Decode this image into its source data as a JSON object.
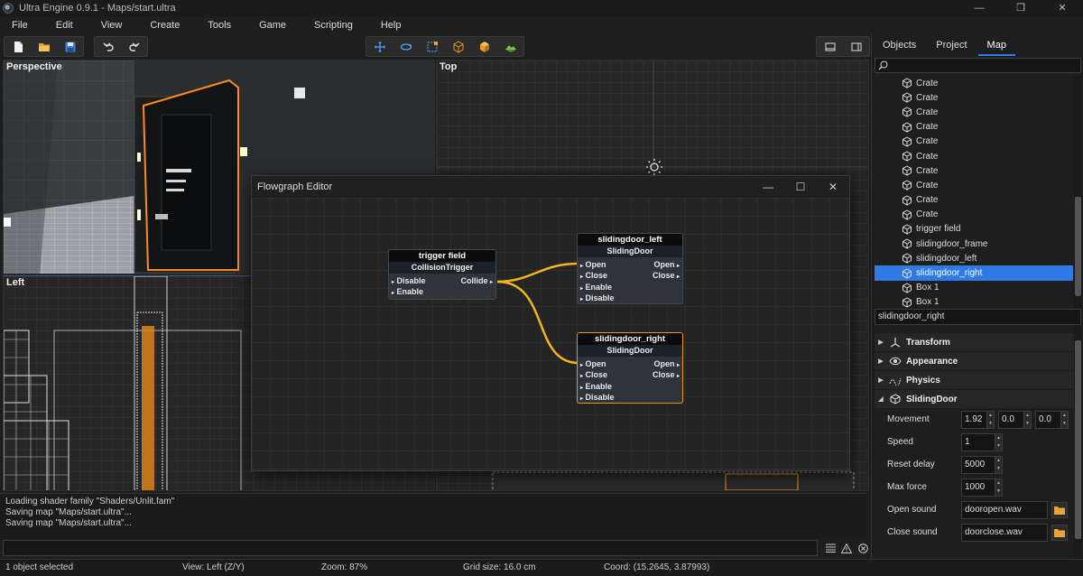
{
  "window": {
    "title": "Ultra Engine 0.9.1 - Maps/start.ultra",
    "min": "—",
    "max": "❐",
    "close": "✕"
  },
  "menu": [
    "File",
    "Edit",
    "View",
    "Create",
    "Tools",
    "Game",
    "Scripting",
    "Help"
  ],
  "viewports": {
    "perspective": "Perspective",
    "top": "Top",
    "left": "Left"
  },
  "console": {
    "lines": [
      "Loading shader family \"Shaders/Unlit.fam\"",
      "Saving map \"Maps/start.ultra\"...",
      "Saving map \"Maps/start.ultra\"..."
    ]
  },
  "status": {
    "selection": "1 object selected",
    "view": "View: Left (Z/Y)",
    "zoom": "Zoom: 87%",
    "grid": "Grid size: 16.0 cm",
    "coord": "Coord: (15.2645, 3.87993)"
  },
  "right_panel": {
    "tabs": [
      "Objects",
      "Project",
      "Map"
    ],
    "active_tab": "Map",
    "tree": [
      "Crate",
      "Crate",
      "Crate",
      "Crate",
      "Crate",
      "Crate",
      "Crate",
      "Crate",
      "Crate",
      "Crate",
      "trigger field",
      "slidingdoor_frame",
      "slidingdoor_left",
      "slidingdoor_right",
      "Box 1",
      "Box 1"
    ],
    "selected_index": 13,
    "name_field": "slidingdoor_right",
    "sections": [
      "Transform",
      "Appearance",
      "Physics",
      "SlidingDoor"
    ],
    "props": {
      "movement_label": "Movement",
      "movement": [
        "1.92",
        "0.0",
        "0.0"
      ],
      "speed_label": "Speed",
      "speed": "1",
      "reset_label": "Reset delay",
      "reset": "5000",
      "maxforce_label": "Max force",
      "maxforce": "1000",
      "opensound_label": "Open sound",
      "opensound": "dooropen.wav",
      "closesound_label": "Close sound",
      "closesound": "doorclose.wav"
    }
  },
  "flowgraph": {
    "title": "Flowgraph Editor",
    "ctrl_min": "—",
    "ctrl_max": "☐",
    "ctrl_close": "✕",
    "trigger": {
      "name": "trigger field",
      "class": "CollisionTrigger",
      "in1": "Disable",
      "in2": "Enable",
      "out1": "Collide"
    },
    "door_left": {
      "name": "slidingdoor_left",
      "class": "SlidingDoor",
      "in1": "Open",
      "in2": "Close",
      "in3": "Enable",
      "in4": "Disable",
      "out1": "Open",
      "out2": "Close"
    },
    "door_right": {
      "name": "slidingdoor_right",
      "class": "SlidingDoor",
      "in1": "Open",
      "in2": "Close",
      "in3": "Enable",
      "in4": "Disable",
      "out1": "Open",
      "out2": "Close"
    },
    "wire_color": "#f2b51a"
  },
  "colors": {
    "accent": "#2f7ae5",
    "selection_orange": "#e59a25"
  }
}
